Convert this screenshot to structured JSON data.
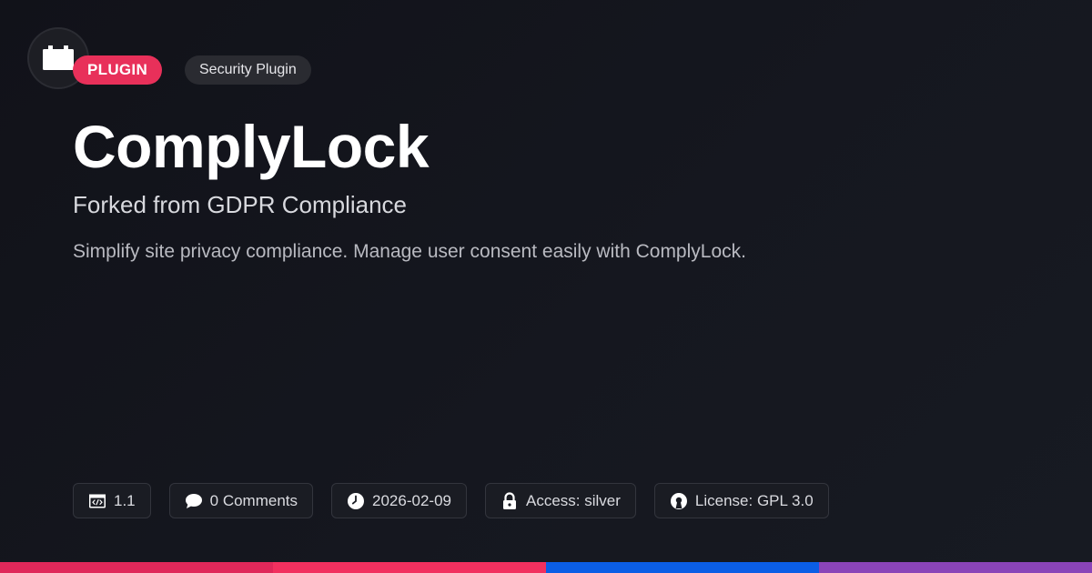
{
  "logo": {
    "icon": "plugin-box-icon"
  },
  "badges": {
    "type_label": "PLUGIN",
    "category_label": "Security Plugin"
  },
  "title": "ComplyLock",
  "subtitle": "Forked from GDPR Compliance",
  "description": "Simplify site privacy compliance. Manage user consent easily with ComplyLock.",
  "meta": {
    "version": {
      "icon": "code-window-icon",
      "text": "1.1"
    },
    "comments": {
      "icon": "comment-bubble-icon",
      "text": "0 Comments"
    },
    "date": {
      "icon": "clock-icon",
      "text": "2026-02-09"
    },
    "access": {
      "icon": "lock-icon",
      "text": "Access: silver"
    },
    "license": {
      "icon": "open-source-icon",
      "text": "License: GPL 3.0"
    }
  },
  "colors": {
    "accent": "#e8305a",
    "background": "#13141b",
    "bar": [
      "#e0285a",
      "#f2305f",
      "#0b5ee6",
      "#8a44b8"
    ]
  }
}
